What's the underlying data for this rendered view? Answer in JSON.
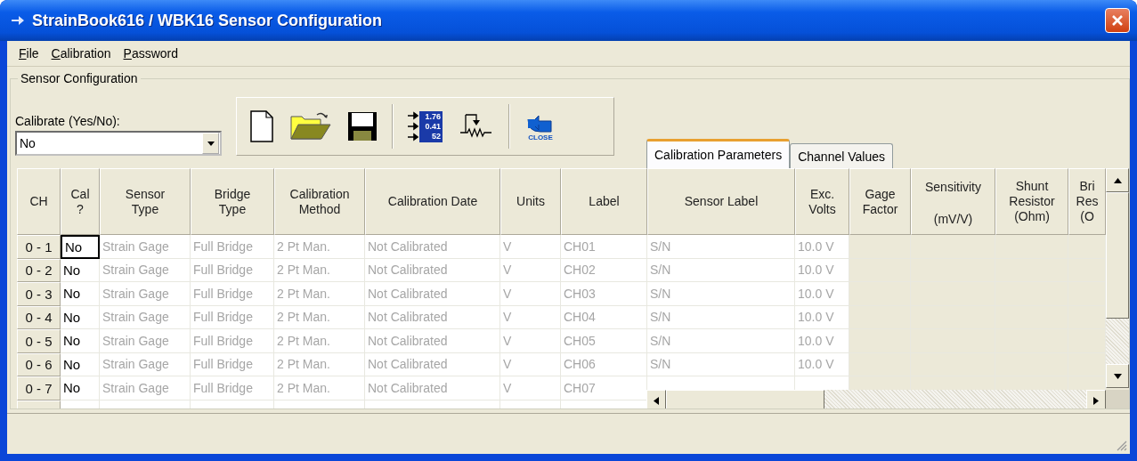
{
  "window": {
    "title": "StrainBook616 / WBK16 Sensor Configuration"
  },
  "menu": [
    {
      "label": "File"
    },
    {
      "label": "Calibration"
    },
    {
      "label": "Password"
    }
  ],
  "group": {
    "title": "Sensor Configuration"
  },
  "calibrate": {
    "label": "Calibrate (Yes/No):",
    "value": "No"
  },
  "toolbar": [
    {
      "buttons": [
        {
          "kind": "new"
        },
        {
          "kind": "open"
        },
        {
          "kind": "save"
        }
      ]
    },
    {
      "buttons": [
        {
          "kind": "readings",
          "lines": [
            "1.76",
            "0.41",
            "52"
          ]
        },
        {
          "kind": "shunt"
        }
      ]
    },
    {
      "buttons": [
        {
          "kind": "close",
          "label": "CLOSE"
        }
      ]
    }
  ],
  "tabs": [
    {
      "label": "Calibration Parameters",
      "selected": true
    },
    {
      "label": "Channel Values",
      "selected": false
    }
  ],
  "table": {
    "columns": [
      {
        "lines": [
          "CH"
        ],
        "spaced": false
      },
      {
        "lines": [
          "Cal",
          "?"
        ],
        "spaced": false
      },
      {
        "lines": [
          "Sensor",
          "Type"
        ],
        "spaced": false
      },
      {
        "lines": [
          "Bridge",
          "Type"
        ],
        "spaced": false
      },
      {
        "lines": [
          "Calibration",
          "Method"
        ],
        "spaced": false
      },
      {
        "lines": [
          "Calibration Date"
        ],
        "spaced": false
      },
      {
        "lines": [
          "Units"
        ],
        "spaced": false
      },
      {
        "lines": [
          "Label"
        ],
        "spaced": false
      },
      {
        "lines": [
          "Sensor Label"
        ],
        "spaced": false
      },
      {
        "lines": [
          "Exc.",
          "Volts"
        ],
        "spaced": false
      },
      {
        "lines": [
          "Gage",
          "Factor"
        ],
        "spaced": false
      },
      {
        "lines": [
          "Sensitivity",
          "(mV/V)"
        ],
        "spaced": true
      },
      {
        "lines": [
          "Shunt",
          "Resistor",
          "(Ohm)"
        ],
        "spaced": false
      },
      {
        "lines": [
          "Bri",
          "Res",
          "(O"
        ],
        "spaced": false
      }
    ],
    "rows": [
      {
        "selected": true,
        "cells": [
          "0 - 1",
          "No",
          "Strain Gage",
          "Full Bridge",
          "2 Pt Man.",
          "Not Calibrated",
          "V",
          "CH01",
          "S/N",
          "10.0 V"
        ]
      },
      {
        "selected": false,
        "cells": [
          "0 - 2",
          "No",
          "Strain Gage",
          "Full Bridge",
          "2 Pt Man.",
          "Not Calibrated",
          "V",
          "CH02",
          "S/N",
          "10.0 V"
        ]
      },
      {
        "selected": false,
        "cells": [
          "0 - 3",
          "No",
          "Strain Gage",
          "Full Bridge",
          "2 Pt Man.",
          "Not Calibrated",
          "V",
          "CH03",
          "S/N",
          "10.0 V"
        ]
      },
      {
        "selected": false,
        "cells": [
          "0 - 4",
          "No",
          "Strain Gage",
          "Full Bridge",
          "2 Pt Man.",
          "Not Calibrated",
          "V",
          "CH04",
          "S/N",
          "10.0 V"
        ]
      },
      {
        "selected": false,
        "cells": [
          "0 - 5",
          "No",
          "Strain Gage",
          "Full Bridge",
          "2 Pt Man.",
          "Not Calibrated",
          "V",
          "CH05",
          "S/N",
          "10.0 V"
        ]
      },
      {
        "selected": false,
        "cells": [
          "0 - 6",
          "No",
          "Strain Gage",
          "Full Bridge",
          "2 Pt Man.",
          "Not Calibrated",
          "V",
          "CH06",
          "S/N",
          "10.0 V"
        ]
      },
      {
        "selected": false,
        "cells": [
          "0 - 7",
          "No",
          "Strain Gage",
          "Full Bridge",
          "2 Pt Man.",
          "Not Calibrated",
          "V",
          "CH07"
        ]
      }
    ]
  }
}
